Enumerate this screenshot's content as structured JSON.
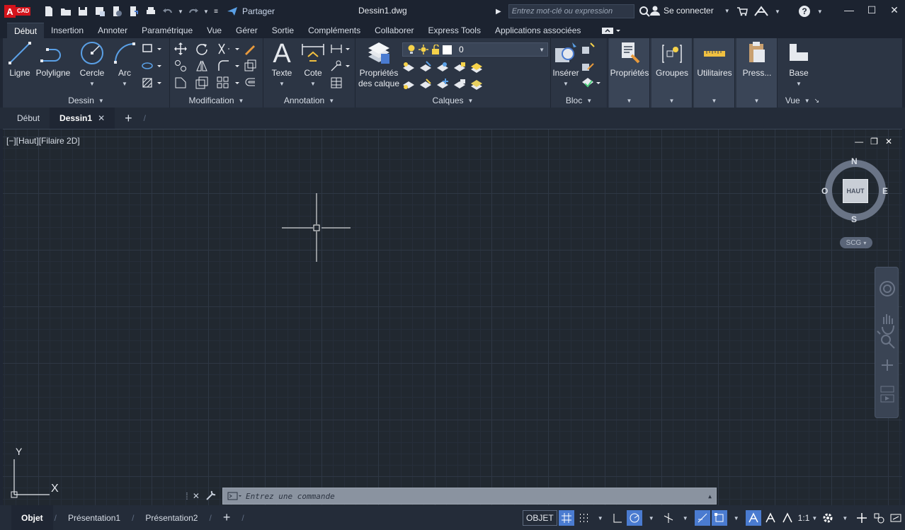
{
  "app": {
    "logo_letter": "A",
    "logo_text": "CAD"
  },
  "titlebar": {
    "share_label": "Partager",
    "doc_title": "Dessin1.dwg",
    "search_placeholder": "Entrez mot-clé ou expression",
    "signin_label": "Se connecter"
  },
  "ribbon_tabs": [
    "Début",
    "Insertion",
    "Annoter",
    "Paramétrique",
    "Vue",
    "Gérer",
    "Sortie",
    "Compléments",
    "Collaborer",
    "Express Tools",
    "Applications associées"
  ],
  "active_ribbon_tab": "Début",
  "ribbon": {
    "dessin": {
      "title": "Dessin",
      "ligne": "Ligne",
      "polyligne": "Polyligne",
      "cercle": "Cercle",
      "arc": "Arc"
    },
    "modification": {
      "title": "Modification"
    },
    "annotation": {
      "title": "Annotation",
      "texte": "Texte",
      "cote": "Cote"
    },
    "calques": {
      "title": "Calques",
      "props_line1": "Propriétés",
      "props_line2": "des calque",
      "layer_value": "0"
    },
    "bloc": {
      "title": "Bloc",
      "inserer": "Insérer"
    },
    "proprietes": "Propriétés",
    "groupes": "Groupes",
    "utilitaires": "Utilitaires",
    "presse": "Press...",
    "vue": {
      "title": "Vue",
      "base": "Base"
    }
  },
  "file_tabs": {
    "start": "Début",
    "current": "Dessin1"
  },
  "viewport": {
    "label": "[−][Haut][Filaire 2D]",
    "viewcube": {
      "n": "N",
      "s": "S",
      "e": "E",
      "w": "O",
      "face": "HAUT"
    },
    "scg": "SCG",
    "ucs_x": "X",
    "ucs_y": "Y"
  },
  "command": {
    "placeholder": "Entrez une commande"
  },
  "layout_tabs": {
    "model": "Objet",
    "layout1": "Présentation1",
    "layout2": "Présentation2"
  },
  "status": {
    "objet": "OBJET",
    "scale": "1:1"
  },
  "colors": {
    "accent": "#4a7bd0",
    "brand": "#d4141c",
    "background": "#1f2633"
  }
}
